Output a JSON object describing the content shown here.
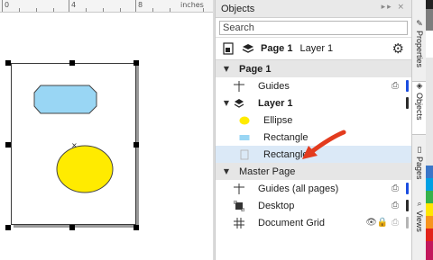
{
  "ruler": {
    "labels": [
      "0",
      "4",
      "8"
    ],
    "unit": "inches"
  },
  "panel": {
    "title": "Objects",
    "search_placeholder": "Search",
    "toolbar": {
      "page": "Page 1",
      "layer": "Layer 1"
    }
  },
  "tree": {
    "page1": "Page 1",
    "guides": "Guides",
    "layer1": "Layer 1",
    "ellipse": "Ellipse",
    "rect1": "Rectangle",
    "rect2": "Rectangle",
    "master": "Master Page",
    "guides_all": "Guides (all pages)",
    "desktop": "Desktop",
    "doc_grid": "Document Grid"
  },
  "sidetabs": {
    "properties": "Properties",
    "objects": "Objects",
    "pages": "Pages",
    "views": "Views"
  },
  "colors": {
    "ellipse_fill": "#FFEB00",
    "rect_fill": "#99D6F4",
    "arrow": "#E33B1E",
    "guides_bar": "#1B4DE0",
    "layer_bar": "#2B2B2B",
    "selected_row": "#DBE9F7"
  },
  "palette": [
    "#222222",
    "#7d7d7d",
    "#ffffff",
    "#e7e7e7",
    "#3a76c8",
    "#00a0e3",
    "#36b24a",
    "#ffe600",
    "#f7941d",
    "#e2231a",
    "#c2185b"
  ]
}
